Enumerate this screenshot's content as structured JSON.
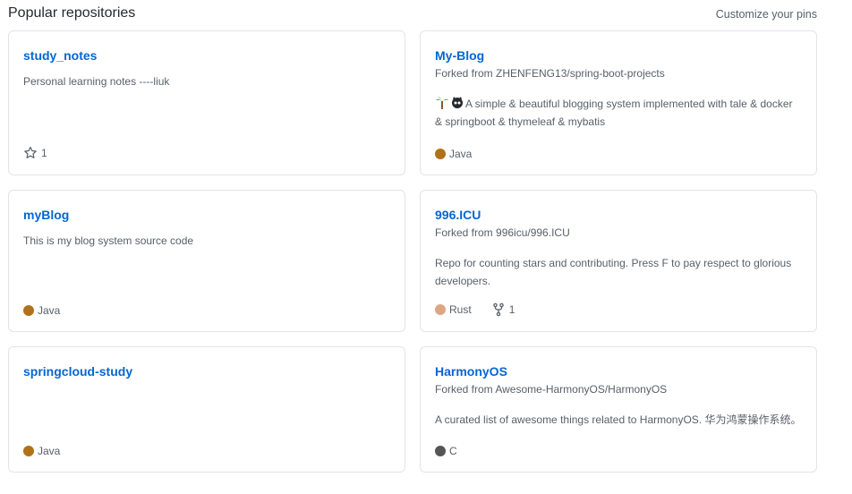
{
  "header": {
    "title": "Popular repositories",
    "customize_label": "Customize your pins"
  },
  "repos": [
    {
      "name": "study_notes",
      "forked_from": "",
      "description": "Personal learning notes ----liuk",
      "language": "",
      "language_color": "",
      "stars": "1",
      "forks": ""
    },
    {
      "name": "My-Blog",
      "forked_from": "Forked from ZHENFENG13/spring-boot-projects",
      "description": "A simple & beautiful blogging system implemented with tale & docker & springboot & thymeleaf & mybatis",
      "language": "Java",
      "language_color": "#b07219",
      "stars": "",
      "forks": ""
    },
    {
      "name": "myBlog",
      "forked_from": "",
      "description": "This is my blog system source code",
      "language": "Java",
      "language_color": "#b07219",
      "stars": "",
      "forks": ""
    },
    {
      "name": "996.ICU",
      "forked_from": "Forked from 996icu/996.ICU",
      "description": "Repo for counting stars and contributing. Press F to pay respect to glorious developers.",
      "language": "Rust",
      "language_color": "#dea584",
      "stars": "",
      "forks": "1"
    },
    {
      "name": "springcloud-study",
      "forked_from": "",
      "description": "",
      "language": "Java",
      "language_color": "#b07219",
      "stars": "",
      "forks": ""
    },
    {
      "name": "HarmonyOS",
      "forked_from": "Forked from Awesome-HarmonyOS/HarmonyOS",
      "description": "A curated list of awesome things related to HarmonyOS. 华为鸿蒙操作系统。",
      "language": "C",
      "language_color": "#555555",
      "stars": "",
      "forks": ""
    }
  ]
}
